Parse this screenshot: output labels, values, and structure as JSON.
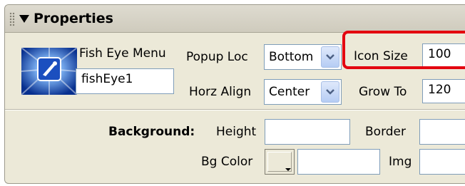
{
  "panel": {
    "title": "Properties"
  },
  "widget": {
    "type_label": "Fish Eye Menu",
    "name_value": "fishEye1"
  },
  "popup_loc": {
    "label": "Popup Loc",
    "value": "Bottom"
  },
  "horz_align": {
    "label": "Horz Align",
    "value": "Center"
  },
  "icon_size": {
    "label": "Icon Size",
    "value": "100"
  },
  "grow_to": {
    "label": "Grow To",
    "value": "120"
  },
  "background": {
    "section_label": "Background:",
    "height_label": "Height",
    "height_value": "",
    "border_label": "Border",
    "border_value": "",
    "bgcolor_label": "Bg Color",
    "bgcolor_value": "",
    "img_label": "Img",
    "img_value": ""
  },
  "colors": {
    "panel_bg": "#ece9d8",
    "highlight": "#e3000f",
    "field_border": "#7f9db9",
    "dropdown_button": "#b6cdf4"
  }
}
